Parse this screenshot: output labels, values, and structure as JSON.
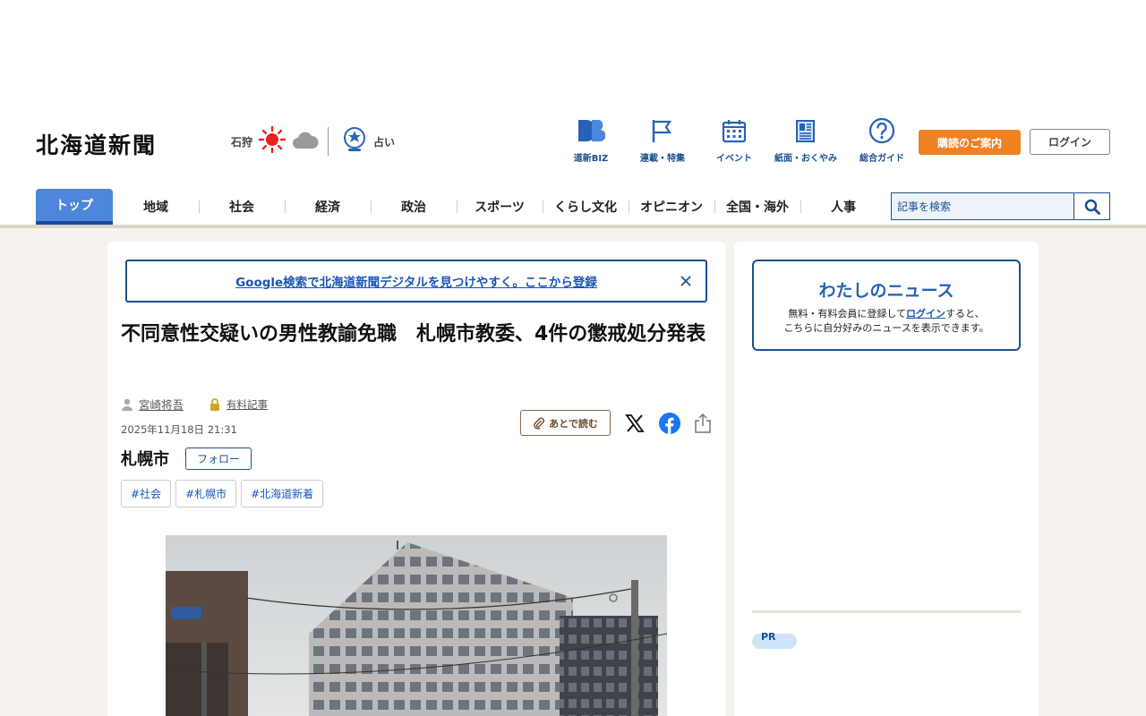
{
  "header": {
    "logo": "北海道新聞",
    "weather_city": "石狩",
    "fortune_label": "占い",
    "icons": [
      {
        "label": "道新BIZ",
        "icon": "biz-icon"
      },
      {
        "label": "連載・特集",
        "icon": "flag-icon"
      },
      {
        "label": "イベント",
        "icon": "calendar-icon"
      },
      {
        "label": "紙面・おくやみ",
        "icon": "newspaper-icon"
      },
      {
        "label": "総合ガイド",
        "icon": "question-icon"
      }
    ],
    "subscribe_label": "購読のご案内",
    "login_label": "ログイン"
  },
  "nav": {
    "items": [
      "トップ",
      "地域",
      "社会",
      "経済",
      "政治",
      "スポーツ",
      "くらし文化",
      "オピニオン",
      "全国・海外",
      "人事"
    ],
    "search_placeholder": "記事を検索"
  },
  "article": {
    "banner_text": "Google検索で北海道新聞デジタルを見つけやすく。ここから登録",
    "title": "不同意性交疑いの男性教諭免職　札幌市教委、4件の懲戒処分発表",
    "author": "宮崎将吾",
    "paid_label": "有料記事",
    "date": "2025年11月18日 21:31",
    "read_later": "あとで読む",
    "location": "札幌市",
    "follow_label": "フォロー",
    "tags": [
      "#社会",
      "#札幌市",
      "#北海道新着"
    ]
  },
  "sidebar": {
    "mynews_title": "わたしのニュース",
    "mynews_line1_before": "無料・有料会員に登録して",
    "mynews_login_link": "ログイン",
    "mynews_line1_after": "すると、",
    "mynews_line2": "こちらに自分好みのニュースを表示できます。",
    "pr_label": "PR"
  },
  "colors": {
    "brand_blue": "#1b4f8e",
    "nav_active": "#4d86db",
    "subscribe_orange": "#f08224",
    "page_bg": "#f6f3ef"
  }
}
